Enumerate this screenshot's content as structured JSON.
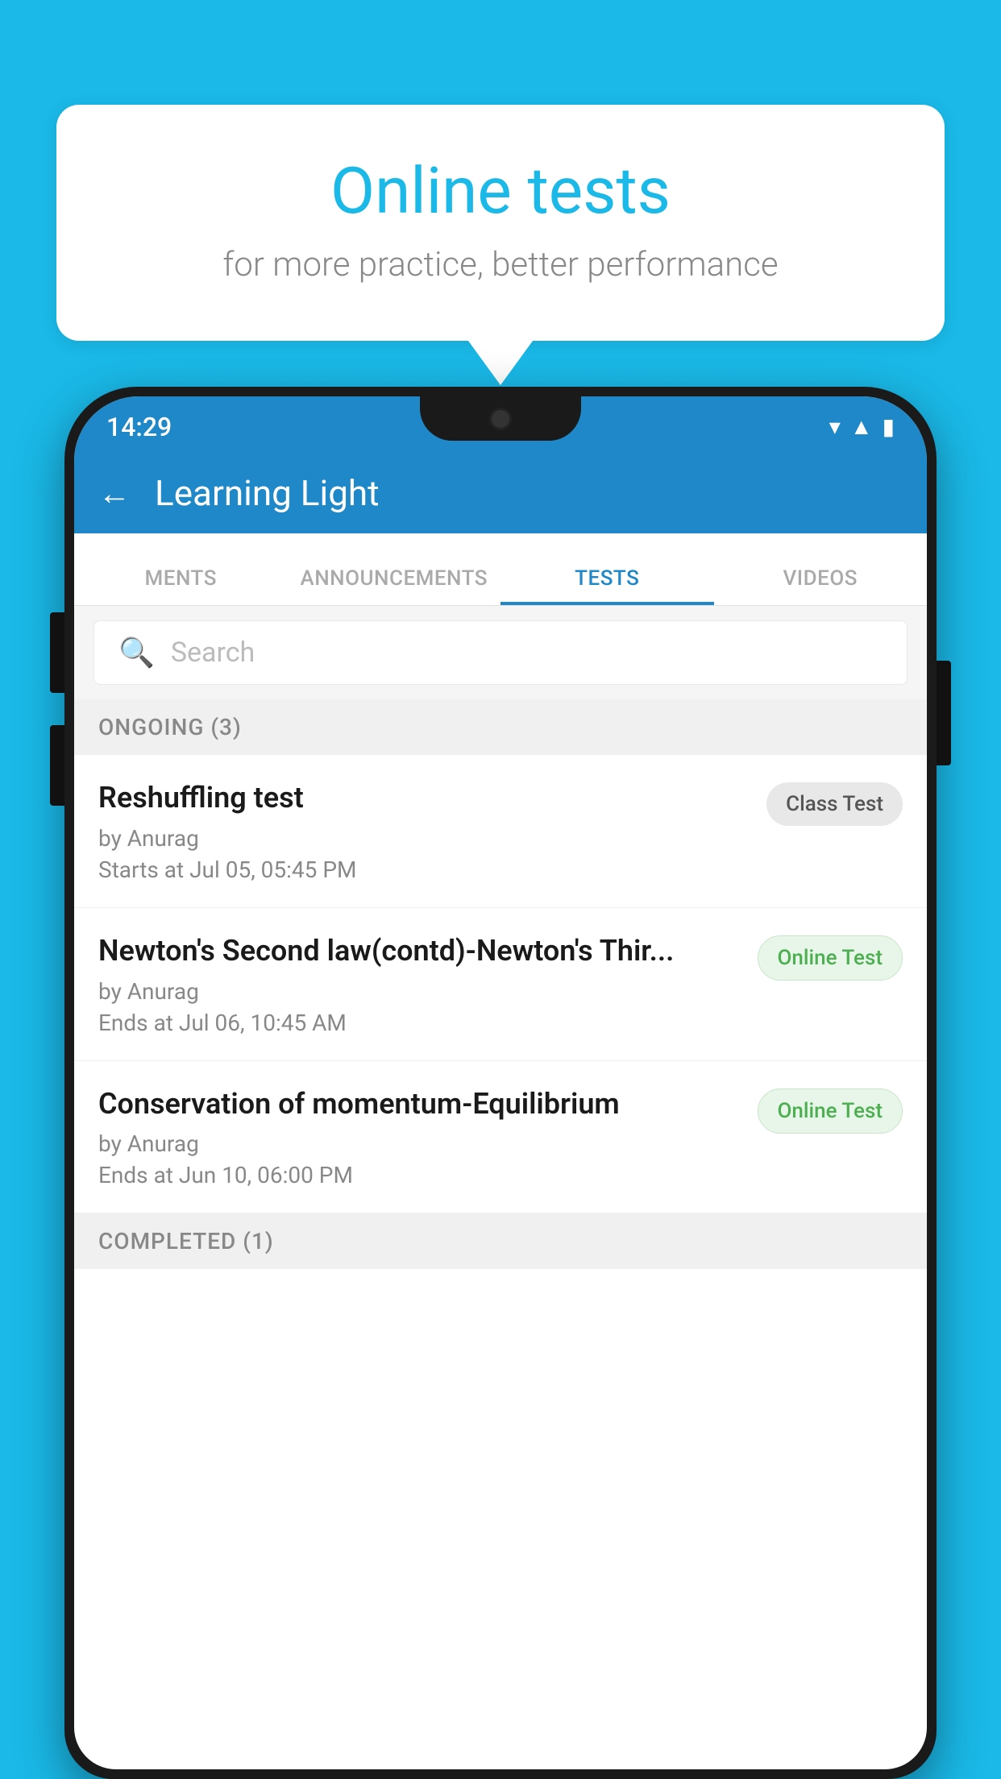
{
  "background_color": "#1ab9e8",
  "speech_bubble": {
    "title": "Online tests",
    "subtitle": "for more practice, better performance"
  },
  "phone": {
    "status_bar": {
      "time": "14:29",
      "icons": [
        "wifi",
        "signal",
        "battery"
      ]
    },
    "app_header": {
      "back_label": "←",
      "title": "Learning Light"
    },
    "tabs": [
      {
        "label": "MENTS",
        "active": false
      },
      {
        "label": "ANNOUNCEMENTS",
        "active": false
      },
      {
        "label": "TESTS",
        "active": true
      },
      {
        "label": "VIDEOS",
        "active": false
      }
    ],
    "search": {
      "placeholder": "Search"
    },
    "ongoing_section": {
      "label": "ONGOING (3)"
    },
    "tests": [
      {
        "name": "Reshuffling test",
        "author": "by Anurag",
        "time": "Starts at  Jul 05, 05:45 PM",
        "badge": "Class Test",
        "badge_type": "class"
      },
      {
        "name": "Newton's Second law(contd)-Newton's Thir...",
        "author": "by Anurag",
        "time": "Ends at  Jul 06, 10:45 AM",
        "badge": "Online Test",
        "badge_type": "online"
      },
      {
        "name": "Conservation of momentum-Equilibrium",
        "author": "by Anurag",
        "time": "Ends at  Jun 10, 06:00 PM",
        "badge": "Online Test",
        "badge_type": "online"
      }
    ],
    "completed_section": {
      "label": "COMPLETED (1)"
    }
  }
}
